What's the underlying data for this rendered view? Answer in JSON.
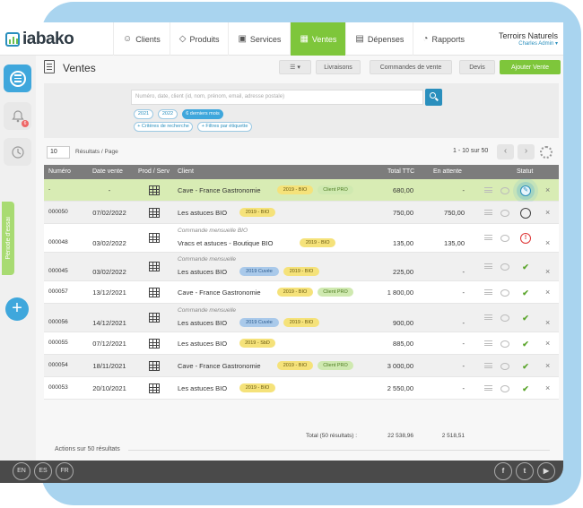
{
  "brand": {
    "name": "iabako"
  },
  "nav": {
    "items": [
      {
        "label": "Clients",
        "icon": "user-icon"
      },
      {
        "label": "Produits",
        "icon": "tag-icon"
      },
      {
        "label": "Services",
        "icon": "toolbox-icon"
      },
      {
        "label": "Ventes",
        "icon": "invoice-icon",
        "active": true
      },
      {
        "label": "Dépenses",
        "icon": "receipt-icon"
      },
      {
        "label": "Rapports",
        "icon": "pie-chart-icon"
      }
    ],
    "account": {
      "org": "Terroirs Naturels",
      "user": "Charles Admin"
    }
  },
  "sidebar": {
    "trial_label": "Période d'essai",
    "notification_count": "6"
  },
  "page": {
    "title": "Ventes",
    "buttons": {
      "livraisons": "Livraisons",
      "commandes": "Commandes de vente",
      "devis": "Devis",
      "ajouter": "Ajouter Vente"
    }
  },
  "filters": {
    "search_placeholder": "Numéro, date, client (id, nom, prénom, email, adresse postale)",
    "chips": [
      "2021",
      "2022",
      "6 derniers mois"
    ],
    "criteria": [
      "+ Critères de recherche",
      "+ Filtres par étiquette"
    ]
  },
  "pager": {
    "per_page": "10",
    "per_page_label": "Résultats / Page",
    "range": "1 - 10 sur 50"
  },
  "table": {
    "headers": {
      "numero": "Numéro",
      "date": "Date vente",
      "prod": "Prod / Serv",
      "client": "Client",
      "ttc": "Total TTC",
      "wait": "En attente",
      "status": "Statut"
    },
    "rows": [
      {
        "num": "-",
        "date": "-",
        "sub": "",
        "client": "Cave - France Gastronomie",
        "tags": [
          "2019 - BIO",
          "Client PRO"
        ],
        "ttc": "680,00",
        "wait": "-",
        "status": "edit"
      },
      {
        "num": "000050",
        "date": "07/02/2022",
        "sub": "",
        "client": "Les astuces BIO",
        "tags": [
          "2019 - BIO"
        ],
        "ttc": "750,00",
        "wait": "750,00",
        "status": "pending"
      },
      {
        "num": "000048",
        "date": "03/02/2022",
        "sub": "Commande mensuelle BIO",
        "client": "Vracs et astuces - Boutique BIO",
        "tags": [
          "2019 - BIO"
        ],
        "ttc": "135,00",
        "wait": "135,00",
        "status": "alert"
      },
      {
        "num": "000045",
        "date": "03/02/2022",
        "sub": "Commande mensuelle",
        "client": "Les astuces BIO",
        "tags": [
          "2019 Cuvée",
          "2019 - BIO"
        ],
        "ttc": "225,00",
        "wait": "-",
        "status": "paid"
      },
      {
        "num": "000057",
        "date": "13/12/2021",
        "sub": "",
        "client": "Cave - France Gastronomie",
        "tags": [
          "2019 - BIO",
          "Client PRO"
        ],
        "ttc": "1 800,00",
        "wait": "-",
        "status": "paid"
      },
      {
        "num": "000056",
        "date": "14/12/2021",
        "sub": "Commande mensuelle",
        "client": "Les astuces BIO",
        "tags": [
          "2019 Cuvée",
          "2019 - BIO"
        ],
        "ttc": "900,00",
        "wait": "-",
        "status": "paid"
      },
      {
        "num": "000055",
        "date": "07/12/2021",
        "sub": "",
        "client": "Les astuces BIO",
        "tags": [
          "2019 - SbD"
        ],
        "ttc": "885,00",
        "wait": "-",
        "status": "paid"
      },
      {
        "num": "000054",
        "date": "18/11/2021",
        "sub": "",
        "client": "Cave - France Gastronomie",
        "tags": [
          "2019 - BIO",
          "Client PRO"
        ],
        "ttc": "3 000,00",
        "wait": "-",
        "status": "paid"
      },
      {
        "num": "000053",
        "date": "20/10/2021",
        "sub": "",
        "client": "Les astuces BIO",
        "tags": [
          "2019 - BIO"
        ],
        "ttc": "2 550,00",
        "wait": "-",
        "status": "paid"
      }
    ],
    "totals": {
      "label": "Total (50 résultats) :",
      "ttc": "22 538,96",
      "wait": "2 518,51"
    }
  },
  "bulk": {
    "label": "Actions sur 50 résultats"
  },
  "footer": {
    "langs": [
      "EN",
      "ES",
      "FR"
    ],
    "social": [
      "f",
      "t",
      "▶"
    ]
  },
  "colors": {
    "accent_green": "#7ec63b",
    "accent_blue": "#3fa7dc",
    "frame_blue": "#a9d4ef"
  }
}
